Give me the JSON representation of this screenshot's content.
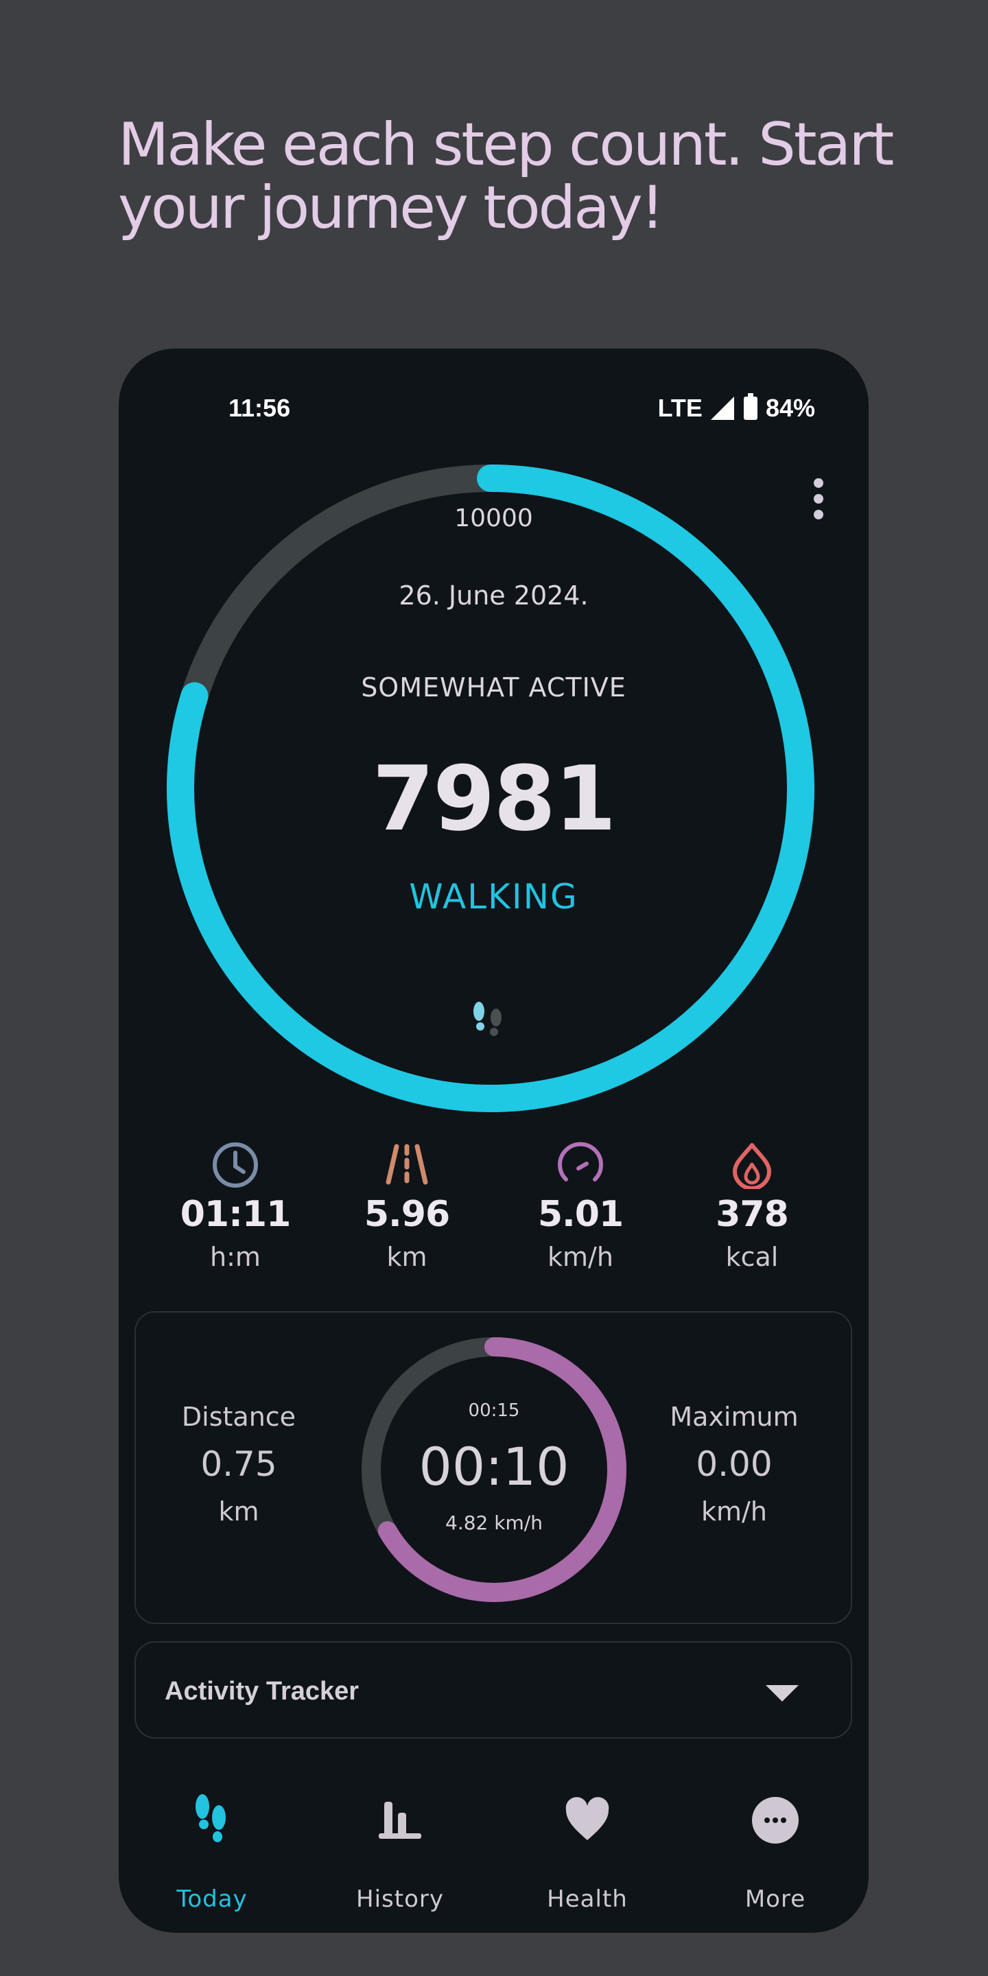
{
  "headline": "Make each step count. Start your journey today!",
  "status_bar": {
    "time": "11:56",
    "network": "LTE",
    "battery": "84%"
  },
  "menu": {
    "icon": "more-vert-icon"
  },
  "step_ring": {
    "goal": 10000,
    "goal_label": "10000",
    "steps": 7981,
    "steps_label": "7981",
    "progress": 0.7981,
    "date": "26. June 2024.",
    "activity_level": "SOMEWHAT ACTIVE",
    "activity_type": "WALKING",
    "colors": {
      "progress": "#1fc8e3",
      "track": "#3d4245"
    }
  },
  "stats": [
    {
      "icon": "clock-icon",
      "value": "01:11",
      "unit": "h:m",
      "color": "#7a8ca8"
    },
    {
      "icon": "road-icon",
      "value": "5.96",
      "unit": "km",
      "color": "#d08a6c"
    },
    {
      "icon": "speedometer-icon",
      "value": "5.01",
      "unit": "km/h",
      "color": "#b371b8"
    },
    {
      "icon": "flame-icon",
      "value": "378",
      "unit": "kcal",
      "color": "#e06464"
    }
  ],
  "timer_card": {
    "distance": {
      "label": "Distance",
      "value": "0.75",
      "unit": "km"
    },
    "maximum": {
      "label": "Maximum",
      "value": "0.00",
      "unit": "km/h"
    },
    "timer": {
      "target": "00:15",
      "elapsed": "00:10",
      "speed": "4.82 km/h",
      "progress": 0.6667
    },
    "colors": {
      "progress": "#a96ba9",
      "track": "#3d4245"
    }
  },
  "activity_tracker": {
    "title": "Activity Tracker",
    "icon": "dropdown-arrow-icon"
  },
  "nav": {
    "active": 0,
    "items": [
      {
        "label": "Today",
        "icon": "footsteps-icon"
      },
      {
        "label": "History",
        "icon": "bar-chart-icon"
      },
      {
        "label": "Health",
        "icon": "heart-icon"
      },
      {
        "label": "More",
        "icon": "more-circle-icon"
      }
    ],
    "active_color": "#22c3df",
    "inactive_color": "#cfcad2"
  }
}
